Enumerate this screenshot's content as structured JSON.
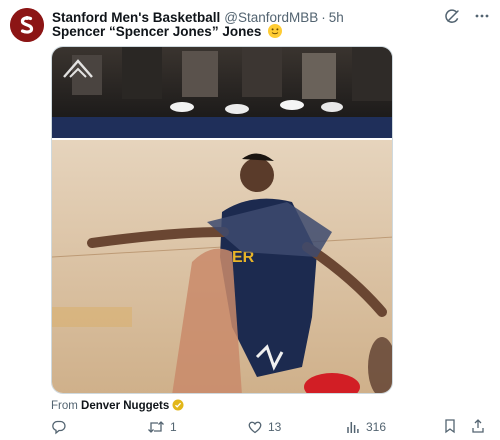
{
  "post": {
    "author": "Stanford Men's Basketball",
    "handle": "@StanfordMBB",
    "separator": "·",
    "time": "5h",
    "text": "Spencer “Spencer Jones” Jones",
    "emoji": "slightly-smiling-face-emoji",
    "brand_color": "#8c1515"
  },
  "source": {
    "prefix": "From",
    "name": "Denver Nuggets",
    "badge": "verified-gold-badge"
  },
  "actions": {
    "reply_count": "",
    "retweet_count": "1",
    "like_count": "13",
    "views_count": "316"
  },
  "icons": [
    "grok-icon",
    "more-icon",
    "reply-icon",
    "retweet-icon",
    "like-icon",
    "views-icon",
    "bookmark-icon",
    "share-icon"
  ]
}
